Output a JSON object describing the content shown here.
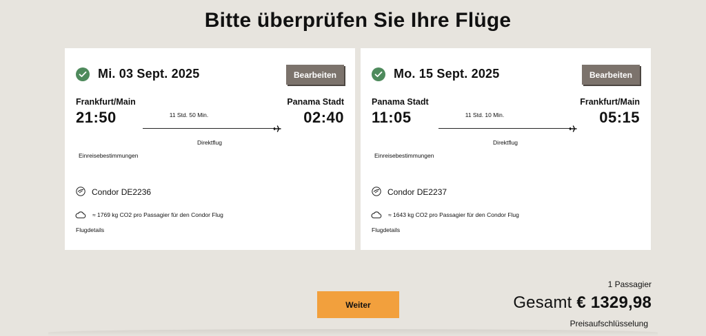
{
  "page": {
    "title": "Bitte überprüfen Sie Ihre Flüge"
  },
  "flights": [
    {
      "date": "Mi. 03 Sept. 2025",
      "edit_label": "Bearbeiten",
      "from_city": "Frankfurt/Main",
      "from_time": "21:50",
      "to_city": "Panama Stadt",
      "to_time": "02:40",
      "duration": "11 Std. 50 Min.",
      "stops": "Direktflug",
      "entry_requirements": "Einreisebestimmungen",
      "airline": "Condor DE2236",
      "co2": "≈ 1769 kg CO2 pro Passagier für den Condor Flug",
      "details_link": "Flugdetails"
    },
    {
      "date": "Mo. 15 Sept. 2025",
      "edit_label": "Bearbeiten",
      "from_city": "Panama Stadt",
      "from_time": "11:05",
      "to_city": "Frankfurt/Main",
      "to_time": "05:15",
      "duration": "11 Std. 10 Min.",
      "stops": "Direktflug",
      "entry_requirements": "Einreisebestimmungen",
      "airline": "Condor DE2237",
      "co2": "≈ 1643 kg CO2 pro Passagier für den Condor Flug",
      "details_link": "Flugdetails"
    }
  ],
  "footer": {
    "continue_label": "Weiter",
    "passengers": "1 Passagier",
    "total_label": "Gesamt",
    "total_price": "€ 1329,98",
    "breakdown_link": "Preisaufschlüsselung"
  },
  "colors": {
    "background": "#e7e4de",
    "check_green": "#4e8a5c",
    "edit_button": "#7c736c",
    "continue_button": "#f2a03d"
  },
  "icons": [
    "check-icon",
    "plane-icon",
    "airline-logo-icon",
    "cloud-icon"
  ]
}
